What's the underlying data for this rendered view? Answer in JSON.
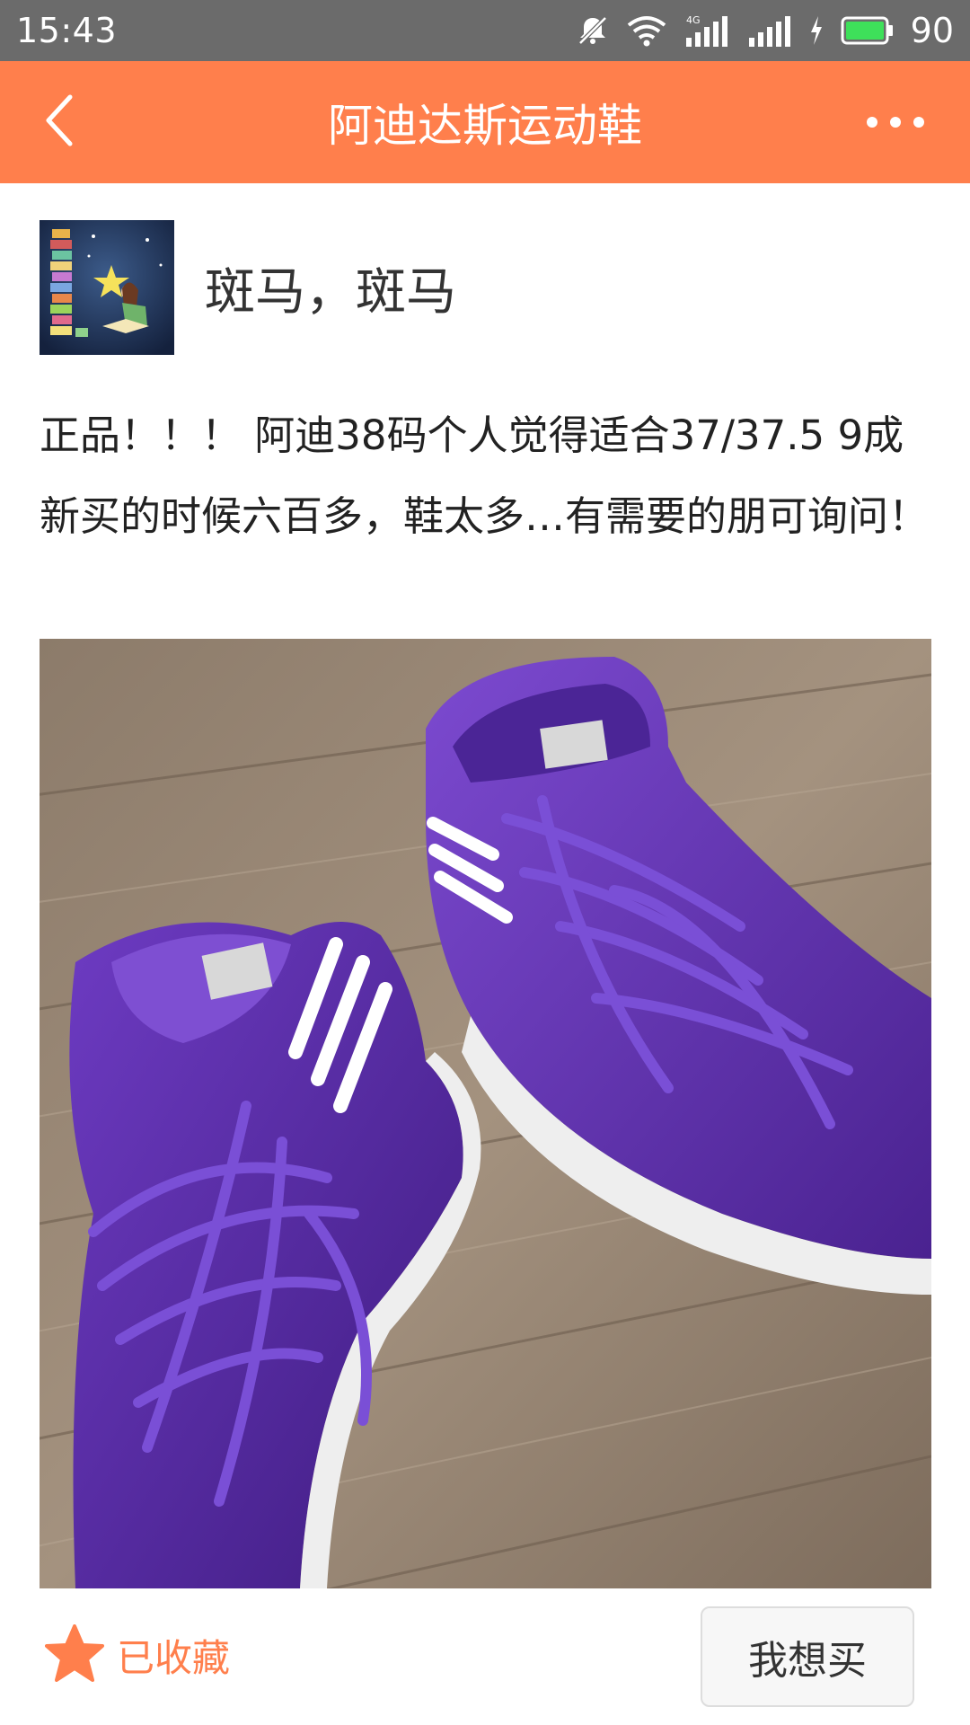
{
  "status_bar": {
    "time": "15:43",
    "battery": "90",
    "icons": [
      "mute-icon",
      "wifi-icon",
      "signal-4g-icon",
      "signal-icon",
      "charging-icon",
      "battery-icon"
    ]
  },
  "header": {
    "title": "阿迪达斯运动鞋",
    "back_icon": "chevron-left-icon",
    "more_icon": "more-dots-icon"
  },
  "seller": {
    "name": "斑马，斑马"
  },
  "post": {
    "description": "正品！！！ 阿迪38码个人觉得适合37/37.5 9成新买的时候六百多，鞋太多…有需要的朋可询问！"
  },
  "bottom_bar": {
    "favorite_label": "已收藏",
    "buy_label": "我想买"
  },
  "colors": {
    "accent": "#ff7f4c",
    "status_bar": "#6b6b6b",
    "shoe": "#5b2ca8"
  }
}
